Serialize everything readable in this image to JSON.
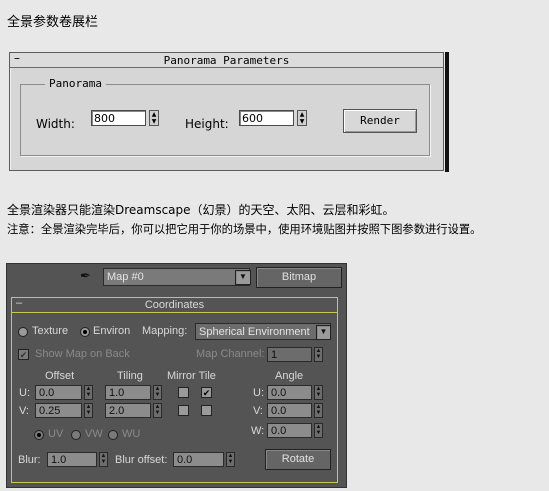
{
  "captions": {
    "heading": "全景参数卷展栏",
    "line1": "全景渲染器只能渲染Dreamscape（幻景）的天空、太阳、云层和彩虹。",
    "line2": "注意：全景渲染完毕后，你可以把它用于你的场景中，使用环境贴图并按照下图参数进行设置。"
  },
  "panorama_panel": {
    "collapse": "–",
    "title": "Panorama Parameters",
    "group_label": "Panorama",
    "width_label": "Width:",
    "width_value": "800",
    "height_label": "Height:",
    "height_value": "600",
    "render_button": "Render"
  },
  "map_panel": {
    "map_name": "Map #0",
    "map_type_button": "Bitmap",
    "rollout_collapse": "–",
    "rollout_title": "Coordinates",
    "texture_label": "Texture",
    "environ_label": "Environ",
    "mapping_label": "Mapping:",
    "mapping_value": "Spherical Environment",
    "show_map_label": "Show Map on Back",
    "map_channel_label": "Map Channel:",
    "map_channel_value": "1",
    "offset_header": "Offset",
    "tiling_header": "Tiling",
    "mirror_tile_header": "Mirror Tile",
    "angle_header": "Angle",
    "u_label": "U:",
    "v_label": "V:",
    "w_label": "W:",
    "offset_u": "0.0",
    "offset_v": "0.25",
    "tiling_u": "1.0",
    "tiling_v": "2.0",
    "angle_u": "0.0",
    "angle_v": "0.0",
    "angle_w": "0.0",
    "uv_label": "UV",
    "vw_label": "VW",
    "wu_label": "WU",
    "blur_label": "Blur:",
    "blur_value": "1.0",
    "blur_offset_label": "Blur offset:",
    "blur_offset_value": "0.0",
    "rotate_button": "Rotate",
    "states": {
      "environ_selected": true,
      "show_map_checked": true,
      "u_tile_checked": true
    }
  },
  "colors": {
    "page_bg": "#e8e8e8",
    "panel_bg": "#d6d6d6",
    "map_panel_bg": "#545454",
    "coord_border": "#c8c850"
  }
}
